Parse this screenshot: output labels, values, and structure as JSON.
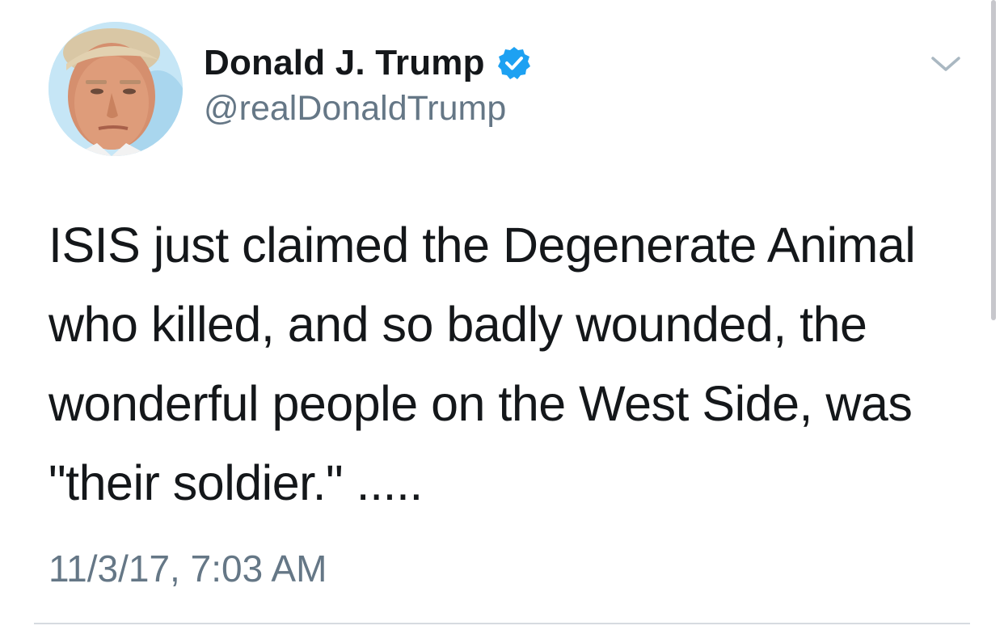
{
  "tweet": {
    "author": {
      "display_name": "Donald J. Trump",
      "handle": "@realDonaldTrump",
      "verified": true,
      "avatar_icon": "profile-photo",
      "verified_icon": "verified-badge-icon"
    },
    "text": "ISIS just claimed the Degenerate Animal who killed, and so badly wounded, the wonderful people on the West Side, was \"their soldier.\" .....",
    "timestamp": "11/3/17, 7:03 AM",
    "menu_icon": "chevron-down-icon"
  },
  "colors": {
    "text_primary": "#14171a",
    "text_secondary": "#657786",
    "verified_blue": "#1da1f2",
    "divider": "#d6dbe0"
  }
}
